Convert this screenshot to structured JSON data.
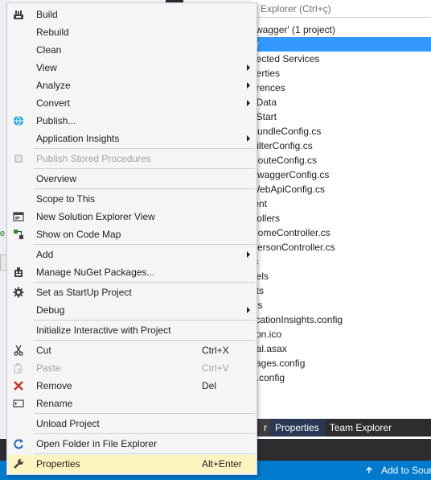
{
  "solution_explorer": {
    "search_placeholder": "Explorer (Ctrl+ç)",
    "tree": [
      "swagger' (1 project)",
      "er",
      "nected Services",
      "perties",
      "erences",
      "_Data",
      "_Start",
      "BundleConfig.cs",
      "FilterConfig.cs",
      "RouteConfig.cs",
      "SwaggerConfig.cs",
      "WebApiConfig.cs",
      "tent",
      "trollers",
      "HomeController.cs",
      "PersonController.cs",
      "ts",
      "dels",
      "pts",
      "ws",
      "licationInsights.config",
      "con.ico",
      "bal.asax",
      "kages.config",
      "b.config"
    ],
    "tabs": [
      "r",
      "Properties",
      "Team Explorer"
    ]
  },
  "status_bar": {
    "add_to_source": "Add to Sour"
  },
  "context_menu": {
    "items": [
      {
        "label": "Build",
        "icon": "build-icon"
      },
      {
        "label": "Rebuild"
      },
      {
        "label": "Clean"
      },
      {
        "label": "View",
        "submenu": true
      },
      {
        "label": "Analyze",
        "submenu": true
      },
      {
        "label": "Convert",
        "submenu": true
      },
      {
        "label": "Publish...",
        "icon": "globe-icon"
      },
      {
        "label": "Application Insights",
        "submenu": true
      },
      {
        "label": "Publish Stored Procedures",
        "icon": "database-icon",
        "disabled": true
      },
      {
        "label": "Overview"
      },
      {
        "label": "Scope to This"
      },
      {
        "label": "New Solution Explorer View",
        "icon": "new-view-icon"
      },
      {
        "label": "Show on Code Map",
        "icon": "code-map-icon"
      },
      {
        "label": "Add",
        "submenu": true
      },
      {
        "label": "Manage NuGet Packages...",
        "icon": "nuget-icon"
      },
      {
        "label": "Set as StartUp Project",
        "icon": "gear-icon"
      },
      {
        "label": "Debug",
        "submenu": true
      },
      {
        "label": "Initialize Interactive with Project"
      },
      {
        "label": "Cut",
        "icon": "scissors-icon",
        "shortcut": "Ctrl+X"
      },
      {
        "label": "Paste",
        "icon": "paste-icon",
        "shortcut": "Ctrl+V",
        "disabled": true
      },
      {
        "label": "Remove",
        "icon": "remove-icon",
        "shortcut": "Del"
      },
      {
        "label": "Rename",
        "icon": "rename-icon"
      },
      {
        "label": "Unload Project"
      },
      {
        "label": "Open Folder in File Explorer",
        "icon": "open-folder-icon"
      },
      {
        "label": "Properties",
        "icon": "wrench-icon",
        "shortcut": "Alt+Enter",
        "highlighted": true
      }
    ]
  }
}
